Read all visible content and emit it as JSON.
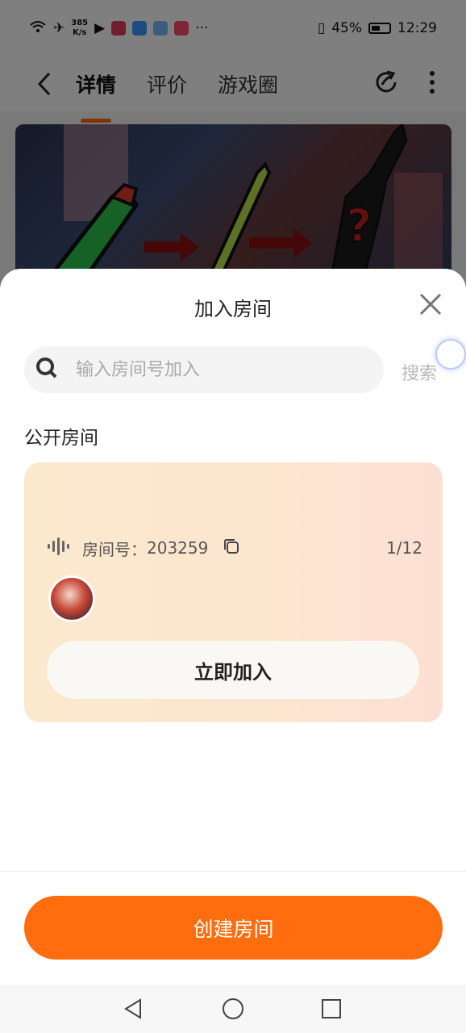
{
  "status_bar": {
    "speed": "385\nK/s",
    "battery": "45%",
    "time": "12:29"
  },
  "nav": {
    "tabs": [
      "详情",
      "评价",
      "游戏圈"
    ]
  },
  "sheet": {
    "title": "加入房间",
    "search_placeholder": "输入房间号加入",
    "search_button": "搜索",
    "section_title": "公开房间",
    "room": {
      "label": "房间号：",
      "number": "203259",
      "count": "1/12",
      "join_button": "立即加入"
    },
    "create_button": "创建房间"
  },
  "colors": {
    "accent": "#ff6d0e"
  }
}
